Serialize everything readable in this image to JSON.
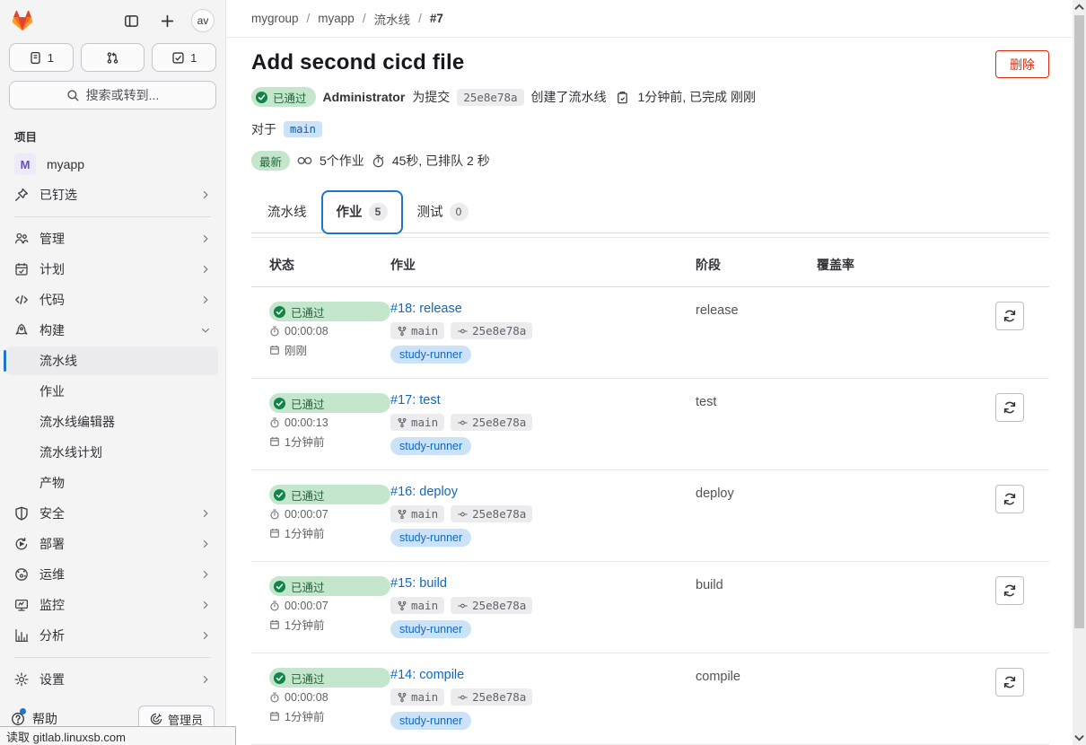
{
  "topbar": {
    "avatar": "av",
    "issues_count": "1",
    "todos_count": "1",
    "search_placeholder": "搜索或转到..."
  },
  "sidebar": {
    "section_label": "项目",
    "project": {
      "initial": "M",
      "name": "myapp"
    },
    "pinned_label": "已钉选",
    "items": [
      {
        "label": "管理"
      },
      {
        "label": "计划"
      },
      {
        "label": "代码"
      },
      {
        "label": "构建"
      },
      {
        "label": "安全"
      },
      {
        "label": "部署"
      },
      {
        "label": "运维"
      },
      {
        "label": "监控"
      },
      {
        "label": "分析"
      },
      {
        "label": "设置"
      }
    ],
    "build_children": [
      {
        "label": "流水线"
      },
      {
        "label": "作业"
      },
      {
        "label": "流水线编辑器"
      },
      {
        "label": "流水线计划"
      },
      {
        "label": "产物"
      }
    ],
    "help_label": "帮助",
    "admin_label": "管理员"
  },
  "breadcrumb": {
    "items": [
      "mygroup",
      "myapp",
      "流水线"
    ],
    "current": "#7"
  },
  "header": {
    "title": "Add second cicd file",
    "delete_label": "删除",
    "status_badge": "已通过",
    "author": "Administrator",
    "for_commit_text": "为提交",
    "commit_sha": "25e8e78a",
    "created_text": "创建了流水线",
    "time_text": "1分钟前, 已完成 刚刚",
    "for_label": "对于",
    "branch": "main",
    "latest_badge": "最新",
    "jobs_count_text": "5个作业",
    "duration_text": "45秒, 已排队 2 秒"
  },
  "tabs": [
    {
      "label": "流水线",
      "badge": ""
    },
    {
      "label": "作业",
      "badge": "5"
    },
    {
      "label": "测试",
      "badge": "0"
    }
  ],
  "table": {
    "headers": [
      "状态",
      "作业",
      "阶段",
      "覆盖率"
    ],
    "rows": [
      {
        "status": "已通过",
        "duration": "00:00:08",
        "age": "刚刚",
        "job": "#18: release",
        "branch": "main",
        "commit": "25e8e78a",
        "runner": "study-runner",
        "stage": "release"
      },
      {
        "status": "已通过",
        "duration": "00:00:13",
        "age": "1分钟前",
        "job": "#17: test",
        "branch": "main",
        "commit": "25e8e78a",
        "runner": "study-runner",
        "stage": "test"
      },
      {
        "status": "已通过",
        "duration": "00:00:07",
        "age": "1分钟前",
        "job": "#16: deploy",
        "branch": "main",
        "commit": "25e8e78a",
        "runner": "study-runner",
        "stage": "deploy"
      },
      {
        "status": "已通过",
        "duration": "00:00:07",
        "age": "1分钟前",
        "job": "#15: build",
        "branch": "main",
        "commit": "25e8e78a",
        "runner": "study-runner",
        "stage": "build"
      },
      {
        "status": "已通过",
        "duration": "00:00:08",
        "age": "1分钟前",
        "job": "#14: compile",
        "branch": "main",
        "commit": "25e8e78a",
        "runner": "study-runner",
        "stage": "compile"
      }
    ]
  },
  "statusbar": {
    "text": "读取 gitlab.linuxsb.com"
  },
  "colors": {
    "accent": "#1f75cb",
    "link": "#1068bf",
    "success_bg": "#c3e6cd",
    "success_text": "#24663b",
    "success_icon": "#108548",
    "info_bg": "#cbe2f9",
    "info_text": "#0b5cad",
    "danger": "#dd2b0e"
  }
}
